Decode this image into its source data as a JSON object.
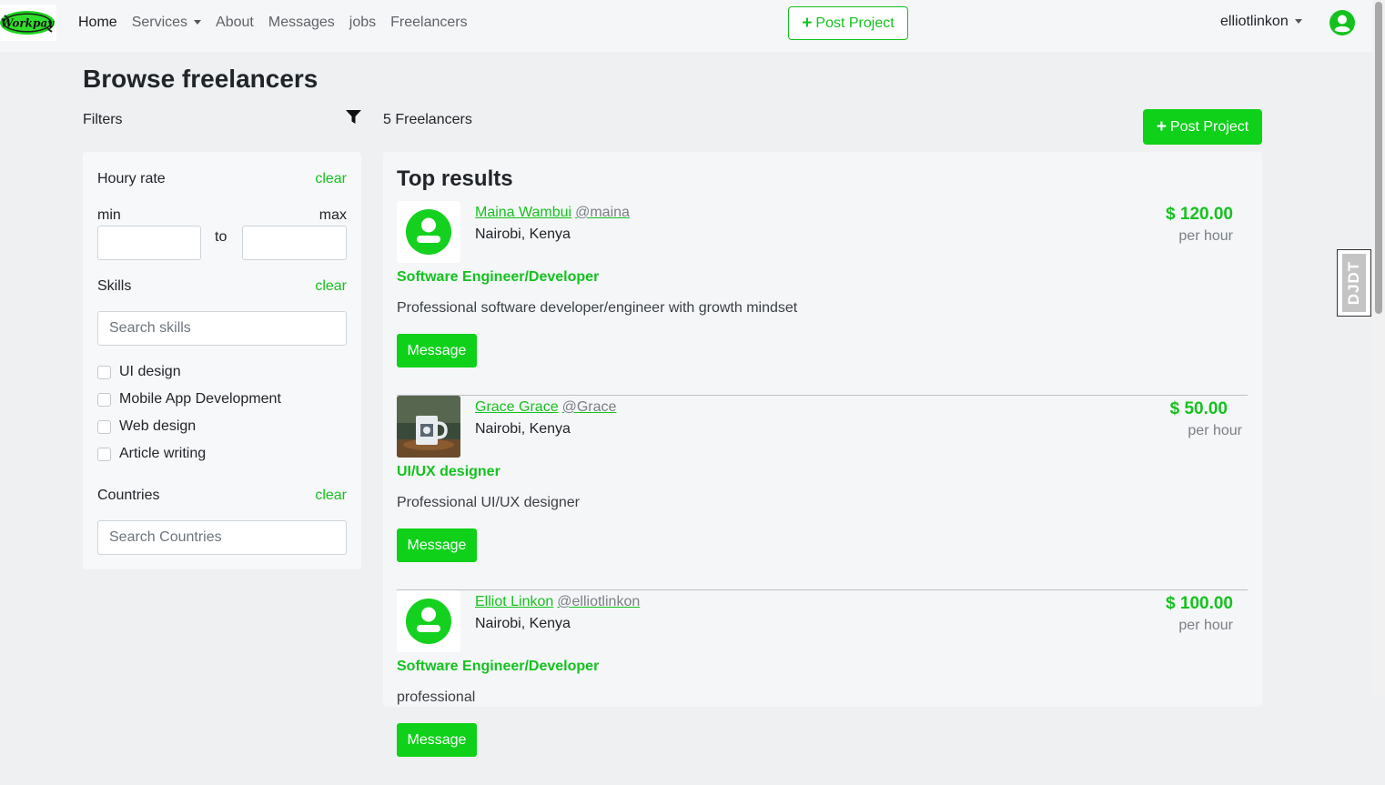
{
  "navbar": {
    "logo_text": "Workpay",
    "links": [
      {
        "label": "Home",
        "active": true,
        "dropdown": false
      },
      {
        "label": "Services",
        "active": false,
        "dropdown": true
      },
      {
        "label": "About",
        "active": false,
        "dropdown": false
      },
      {
        "label": "Messages",
        "active": false,
        "dropdown": false
      },
      {
        "label": "jobs",
        "active": false,
        "dropdown": false
      },
      {
        "label": "Freelancers",
        "active": false,
        "dropdown": false
      }
    ],
    "post_project_label": "Post Project",
    "username": "elliotlinkon",
    "user_icon": "user-circle-icon"
  },
  "page": {
    "title": "Browse freelancers",
    "filters_label": "Filters",
    "filter_icon": "funnel-icon",
    "count_label": "5 Freelancers",
    "post_project_label": "Post Project"
  },
  "sidebar": {
    "hourly": {
      "label": "Houry rate",
      "clear": "clear",
      "min_label": "min",
      "max_label": "max",
      "to_label": "to",
      "min_value": "",
      "max_value": ""
    },
    "skills": {
      "label": "Skills",
      "clear": "clear",
      "placeholder": "Search skills",
      "options": [
        "UI design",
        "Mobile App Development",
        "Web design",
        "Article writing"
      ]
    },
    "countries": {
      "label": "Countries",
      "clear": "clear",
      "placeholder": "Search Countries"
    }
  },
  "results": {
    "title": "Top results",
    "freelancers": [
      {
        "name": "Maina Wambui",
        "username": "@maina",
        "location": "Nairobi, Kenya",
        "title": "Software Engineer/Developer",
        "description": "Professional software developer/engineer with growth mindset",
        "rate": "$ 120.00",
        "per": "per hour",
        "message_label": "Message",
        "avatar": "user-avatar-icon"
      },
      {
        "name": "Grace Grace",
        "username": "@Grace",
        "location": "Nairobi, Kenya",
        "title": "UI/UX designer",
        "description": "Professional UI/UX designer",
        "rate": "$ 50.00",
        "per": "per hour",
        "message_label": "Message",
        "avatar": "mug-photo"
      },
      {
        "name": "Elliot Linkon",
        "username": "@elliotlinkon",
        "location": "Nairobi, Kenya",
        "title": "Software Engineer/Developer",
        "description": "professional",
        "rate": "$ 100.00",
        "per": "per hour",
        "message_label": "Message",
        "avatar": "user-avatar-icon"
      }
    ]
  },
  "debug_toolbar": {
    "label": "DJDT"
  },
  "colors": {
    "accent": "#14c21e",
    "button": "#0fd11a",
    "background": "#eef0f2"
  }
}
